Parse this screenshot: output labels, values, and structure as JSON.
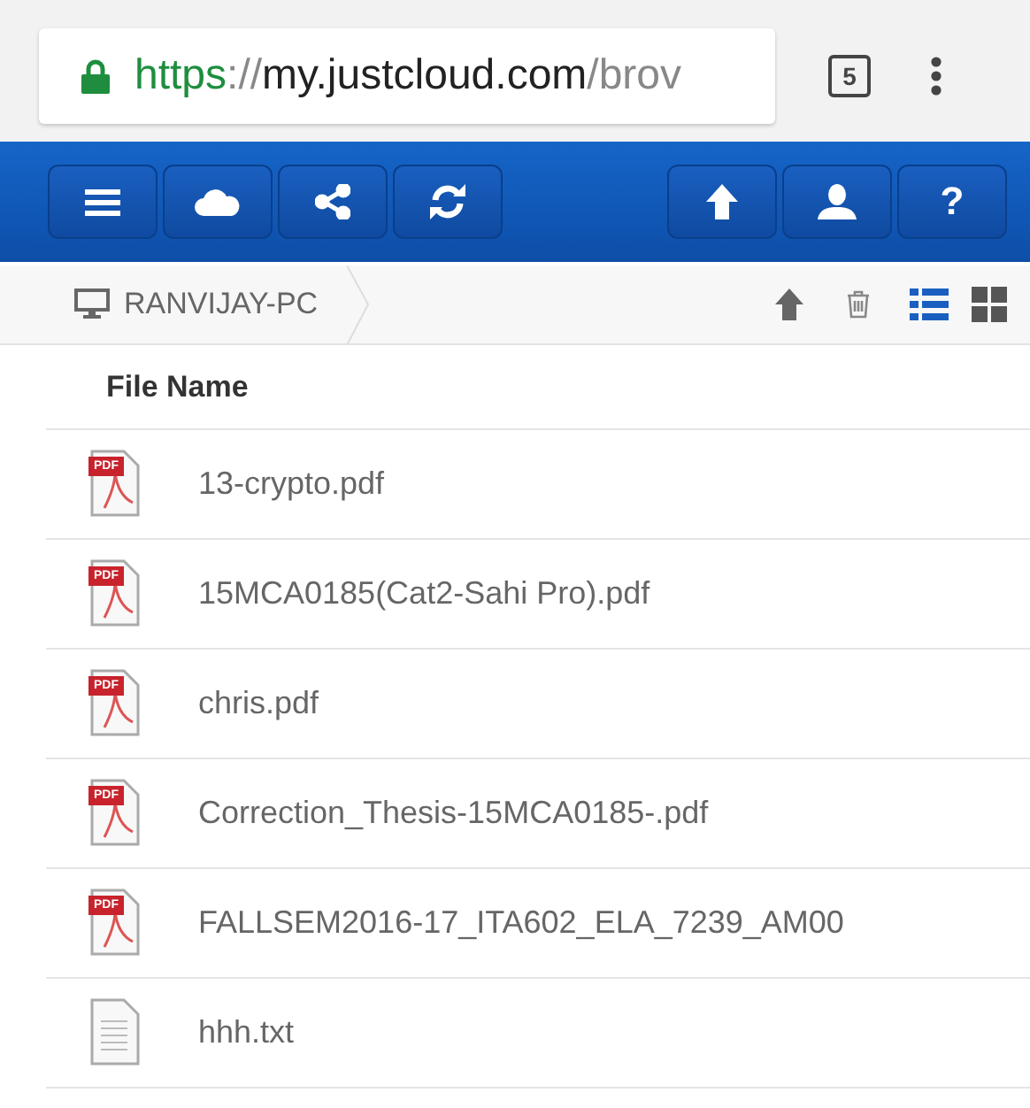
{
  "browser": {
    "url": [
      {
        "text": "https",
        "kind": "scheme"
      },
      {
        "text": "://",
        "kind": "dim"
      },
      {
        "text": "my.justcloud.com",
        "kind": "host"
      },
      {
        "text": "/brov",
        "kind": "dim"
      }
    ],
    "tab_count": "5"
  },
  "toolbar": {
    "left": [
      {
        "kind": "menu"
      },
      {
        "kind": "cloud"
      },
      {
        "kind": "share"
      },
      {
        "kind": "refresh"
      }
    ],
    "right": [
      {
        "kind": "upload"
      },
      {
        "kind": "user"
      },
      {
        "kind": "help",
        "text": "?"
      }
    ]
  },
  "breadcrumb": {
    "label": "RANVIJAY-PC",
    "views": [
      {
        "kind": "list",
        "selected": true
      },
      {
        "kind": "grid",
        "selected": false
      }
    ]
  },
  "table": {
    "column": "File Name",
    "rows": [
      {
        "name": "13-crypto.pdf",
        "kind": "pdf",
        "badge": "PDF"
      },
      {
        "name": "15MCA0185(Cat2-Sahi Pro).pdf",
        "kind": "pdf",
        "badge": "PDF"
      },
      {
        "name": "chris.pdf",
        "kind": "pdf",
        "badge": "PDF"
      },
      {
        "name": "Correction_Thesis-15MCA0185-.pdf",
        "kind": "pdf",
        "badge": "PDF"
      },
      {
        "name": "FALLSEM2016-17_ITA602_ELA_7239_AM00",
        "kind": "pdf",
        "badge": "PDF"
      },
      {
        "name": "hhh.txt",
        "kind": "txt"
      }
    ]
  }
}
